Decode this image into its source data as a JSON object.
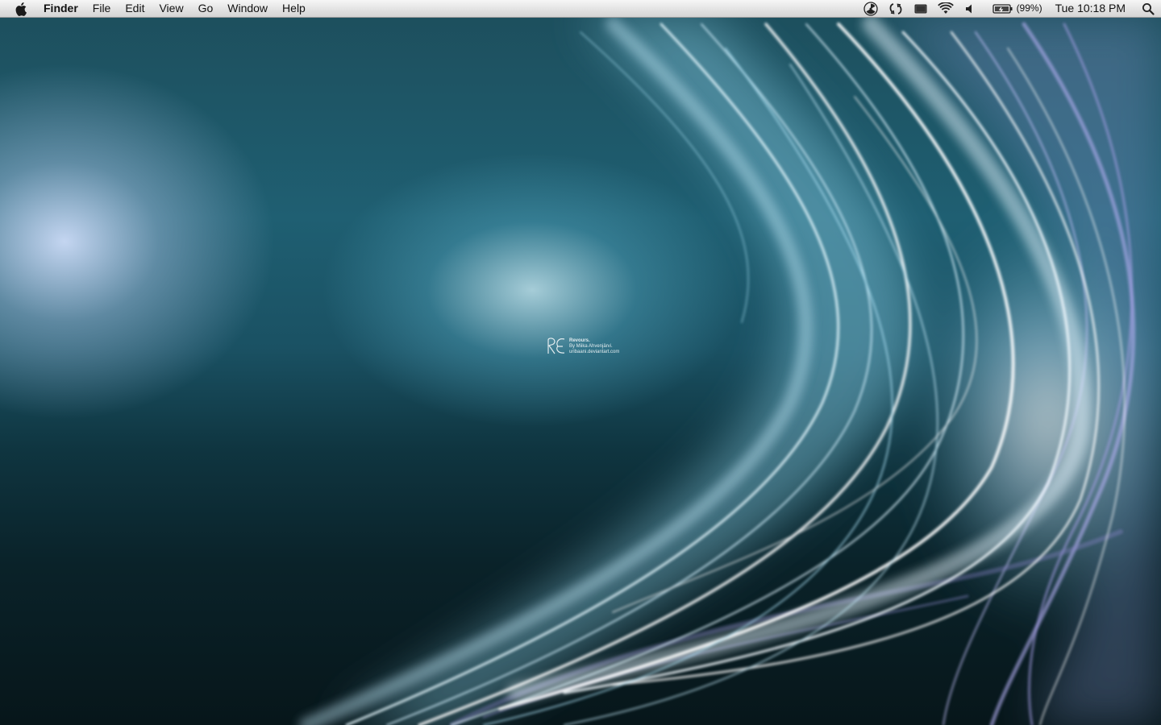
{
  "menubar": {
    "apple_icon": "apple-icon",
    "app_name": "Finder",
    "menus": [
      "File",
      "Edit",
      "View",
      "Go",
      "Window",
      "Help"
    ],
    "status": {
      "icons": [
        "radiation-icon",
        "sync-icon",
        "display-icon",
        "wifi-icon",
        "volume-icon",
        "battery-icon"
      ],
      "battery_percent": "(99%)",
      "clock": "Tue 10:18 PM",
      "spotlight_icon": "spotlight-search-icon"
    }
  },
  "wallpaper": {
    "signature": {
      "monogram": "RE",
      "title": "Revours.",
      "author": "By Miika Ahvenjärvi.",
      "url": "uribaani.deviantart.com"
    }
  },
  "colors": {
    "menubar_top": "#f6f6f6",
    "menubar_bottom": "#d4d4d4",
    "wallpaper_teal": "#1f5f72",
    "wallpaper_dark": "#07161a",
    "light_streak": "#cfefff",
    "violet_streak": "#a9a6e0"
  }
}
